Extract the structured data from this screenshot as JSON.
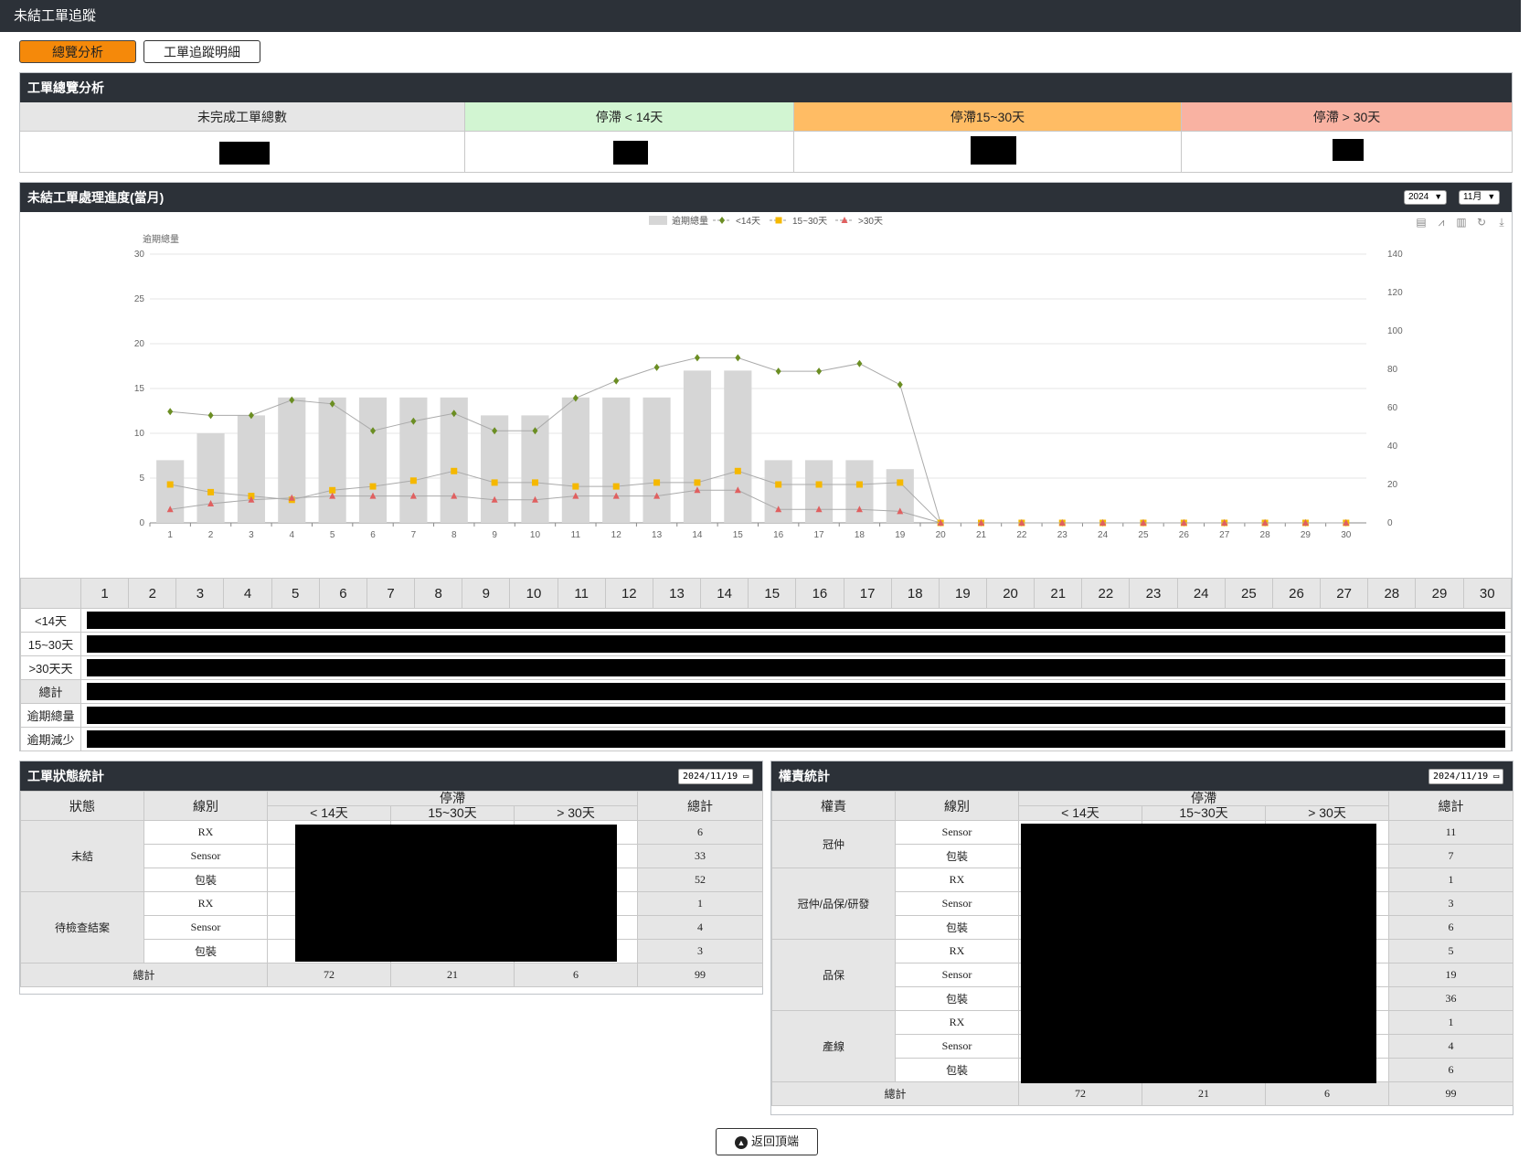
{
  "header": {
    "title": "未結工單追蹤"
  },
  "tabs": [
    {
      "label": "總覽分析",
      "active": true
    },
    {
      "label": "工單追蹤明細",
      "active": false
    }
  ],
  "overview": {
    "title": "工單總覽分析",
    "columns": [
      {
        "label": "未完成工單總數",
        "color": "#e6e6e6"
      },
      {
        "label": "停滯 < 14天",
        "color": "#d2f5d2"
      },
      {
        "label": "停滯15~30天",
        "color": "#ffbc64"
      },
      {
        "label": "停滯 > 30天",
        "color": "#f9b2a2"
      }
    ]
  },
  "progress": {
    "title": "未結工單處理進度(當月)",
    "year": "2024",
    "month": "11月",
    "row_labels": [
      "<14天",
      "15~30天",
      ">30天天",
      "總計",
      "逾期總量",
      "逾期減少"
    ]
  },
  "chart_data": {
    "type": "bar",
    "legend": [
      "逾期總量",
      "<14天",
      "15~30天",
      ">30天"
    ],
    "legend_position": "top-center",
    "ylabel": "逾期總量",
    "x": [
      "1",
      "2",
      "3",
      "4",
      "5",
      "6",
      "7",
      "8",
      "9",
      "10",
      "11",
      "12",
      "13",
      "14",
      "15",
      "16",
      "17",
      "18",
      "19",
      "20",
      "21",
      "22",
      "23",
      "24",
      "25",
      "26",
      "27",
      "28",
      "29",
      "30"
    ],
    "left_axis": {
      "ticks": [
        "0",
        "5",
        "10",
        "15",
        "20",
        "25",
        "30"
      ],
      "range": [
        0,
        30
      ]
    },
    "right_axis": {
      "ticks": [
        "0",
        "20",
        "40",
        "60",
        "80",
        "100",
        "120",
        "140"
      ],
      "range": [
        0,
        140
      ]
    },
    "grid": true,
    "series": [
      {
        "name": "逾期總量",
        "kind": "bar",
        "axis": "left",
        "color": "#d6d6d6",
        "values": [
          7,
          10,
          12,
          14,
          14,
          14,
          14,
          14,
          12,
          12,
          14,
          14,
          14,
          17,
          17,
          7,
          7,
          7,
          6,
          0,
          0,
          0,
          0,
          0,
          0,
          0,
          0,
          0,
          0,
          0
        ]
      },
      {
        "name": "<14天",
        "kind": "line",
        "axis": "right",
        "color": "#6b8e23",
        "marker": "diamond",
        "values": [
          58,
          56,
          56,
          64,
          62,
          48,
          53,
          57,
          48,
          48,
          65,
          74,
          81,
          86,
          86,
          79,
          79,
          83,
          72,
          0,
          0,
          0,
          0,
          0,
          0,
          0,
          0,
          0,
          0,
          0
        ]
      },
      {
        "name": "15~30天",
        "kind": "line",
        "axis": "right",
        "color": "#f5b800",
        "marker": "square",
        "values": [
          20,
          16,
          14,
          12,
          17,
          19,
          22,
          27,
          21,
          21,
          19,
          19,
          21,
          21,
          27,
          20,
          20,
          20,
          21,
          0,
          0,
          0,
          0,
          0,
          0,
          0,
          0,
          0,
          0,
          0
        ]
      },
      {
        "name": ">30天",
        "kind": "line",
        "axis": "right",
        "color": "#e06060",
        "marker": "triangle",
        "values": [
          7,
          10,
          12,
          13,
          14,
          14,
          14,
          14,
          12,
          12,
          14,
          14,
          14,
          17,
          17,
          7,
          7,
          7,
          6,
          0,
          0,
          0,
          0,
          0,
          0,
          0,
          0,
          0,
          0,
          0
        ]
      }
    ]
  },
  "status_stats": {
    "title": "工單狀態統計",
    "date": "2024/11/19",
    "headers": {
      "status": "狀態",
      "line": "線別",
      "stagnant": "停滯",
      "lt14": "< 14天",
      "d15_30": "15~30天",
      "gt30": "> 30天",
      "total": "總計"
    },
    "groups": [
      {
        "status": "未結",
        "rows": [
          {
            "line": "RX",
            "total": "6"
          },
          {
            "line": "Sensor",
            "total": "33"
          },
          {
            "line": "包裝",
            "total": "52"
          }
        ]
      },
      {
        "status": "待檢查結案",
        "rows": [
          {
            "line": "RX",
            "total": "1"
          },
          {
            "line": "Sensor",
            "total": "4"
          },
          {
            "line": "包裝",
            "total": "3"
          }
        ]
      }
    ],
    "footer": {
      "label": "總計",
      "lt14": "72",
      "d15_30": "21",
      "gt30": "6",
      "total": "99"
    }
  },
  "owner_stats": {
    "title": "權責統計",
    "date": "2024/11/19",
    "headers": {
      "owner": "權責",
      "line": "線別",
      "stagnant": "停滯",
      "lt14": "< 14天",
      "d15_30": "15~30天",
      "gt30": "> 30天",
      "total": "總計"
    },
    "groups": [
      {
        "owner": "冠仲",
        "rows": [
          {
            "line": "Sensor",
            "total": "11"
          },
          {
            "line": "包裝",
            "total": "7"
          }
        ]
      },
      {
        "owner": "冠仲/品保/研發",
        "rows": [
          {
            "line": "RX",
            "total": "1"
          },
          {
            "line": "Sensor",
            "total": "3"
          },
          {
            "line": "包裝",
            "total": "6"
          }
        ]
      },
      {
        "owner": "品保",
        "rows": [
          {
            "line": "RX",
            "total": "5"
          },
          {
            "line": "Sensor",
            "total": "19"
          },
          {
            "line": "包裝",
            "total": "36"
          }
        ]
      },
      {
        "owner": "產線",
        "rows": [
          {
            "line": "RX",
            "total": "1"
          },
          {
            "line": "Sensor",
            "total": "4"
          },
          {
            "line": "包裝",
            "total": "6"
          }
        ]
      }
    ],
    "footer": {
      "label": "總計",
      "lt14": "72",
      "d15_30": "21",
      "gt30": "6",
      "total": "99"
    }
  },
  "back_to_top": {
    "label": "返回頂端",
    "icon": "chevron-up-circle-icon"
  }
}
